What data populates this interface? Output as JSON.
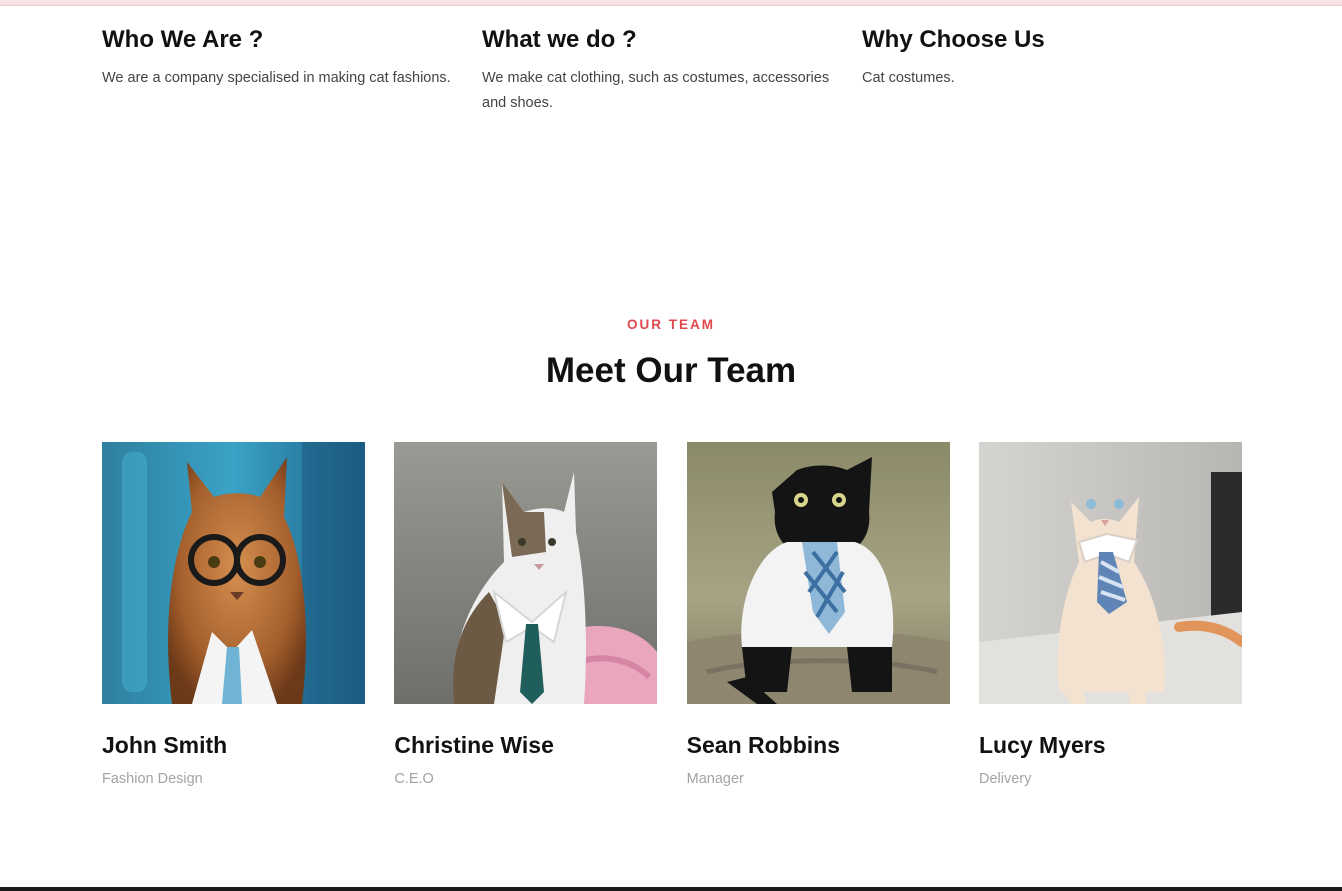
{
  "about": [
    {
      "title": "Who We Are ?",
      "text": "We are a company specialised in making cat fashions."
    },
    {
      "title": "What we do ?",
      "text": "We make cat clothing, such as costumes, accessories and shoes."
    },
    {
      "title": "Why Choose Us",
      "text": "Cat costumes."
    }
  ],
  "team": {
    "eyebrow": "OUR TEAM",
    "title": "Meet Our Team",
    "members": [
      {
        "name": "John Smith",
        "role": "Fashion Design"
      },
      {
        "name": "Christine Wise",
        "role": "C.E.O"
      },
      {
        "name": "Sean Robbins",
        "role": "Manager"
      },
      {
        "name": "Lucy Myers",
        "role": "Delivery"
      }
    ]
  },
  "colors": {
    "accent": "#e0474c",
    "heading": "#111111",
    "body_text": "#444444",
    "muted": "#a3a3a3",
    "top_strip": "#f9e3e7"
  }
}
